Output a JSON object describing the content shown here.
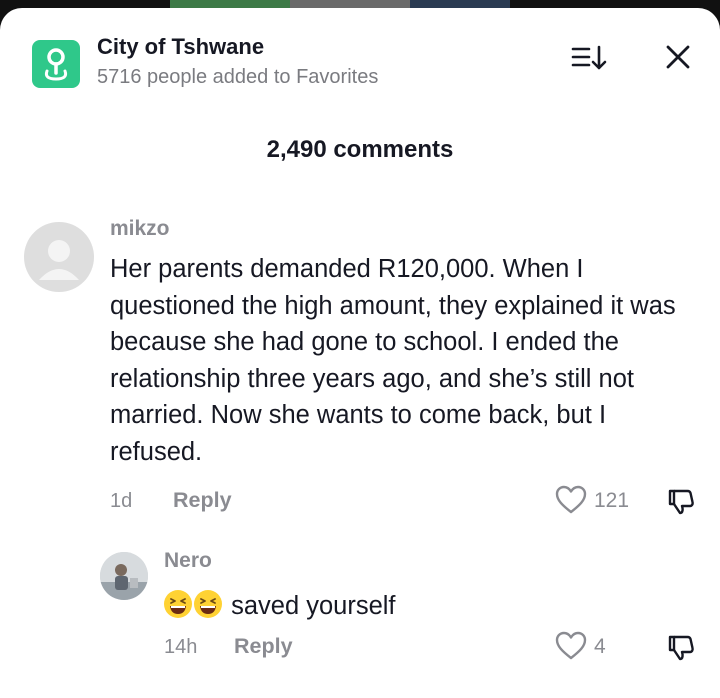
{
  "header": {
    "title": "City of Tshwane",
    "favorites": "5716 people added to Favorites"
  },
  "comments_count": "2,490 comments",
  "comments": [
    {
      "username": "mikzo",
      "text": "Her parents demanded R120,000. When I questioned the high amount, they explained it was because she had gone to school. I ended the relationship three years ago, and she’s still not married. Now she wants to come back, but I refused.",
      "time": "1d",
      "reply_label": "Reply",
      "likes": "121"
    },
    {
      "username": "Nero",
      "text": "saved yourself",
      "emoji": [
        "grinning-squinting-face",
        "grinning-squinting-face"
      ],
      "time": "14h",
      "reply_label": "Reply",
      "likes": "4"
    }
  ],
  "colors": {
    "accent": "#2fc88a",
    "text": "#161823",
    "muted": "#8a8b91"
  }
}
